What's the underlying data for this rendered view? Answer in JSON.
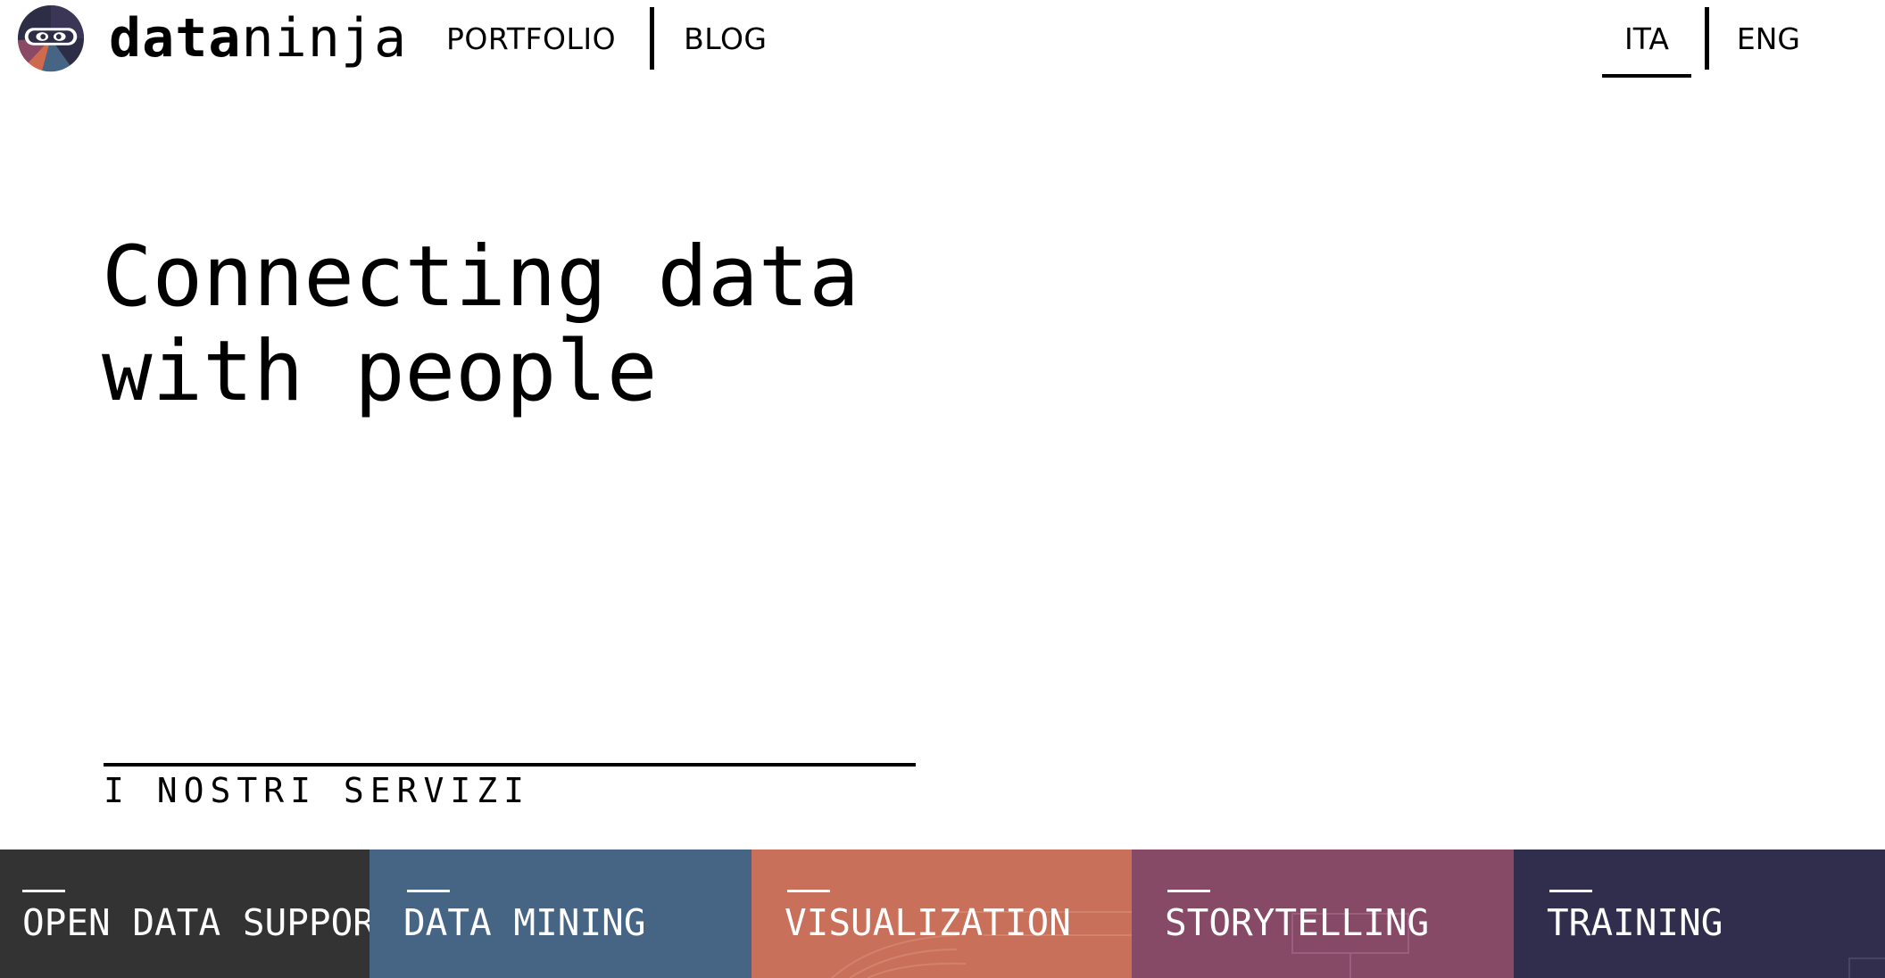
{
  "header": {
    "logo": {
      "text_bold": "data",
      "text_light": "ninja",
      "colors": {
        "dark": "#2d2e45",
        "purple": "#3b3656",
        "rose": "#8a4a66",
        "orange": "#d06a4f",
        "blue": "#466585"
      }
    },
    "nav": [
      {
        "label": "PORTFOLIO"
      },
      {
        "label": "BLOG"
      }
    ],
    "languages": [
      {
        "label": "ITA",
        "active": true
      },
      {
        "label": "ENG",
        "active": false
      }
    ]
  },
  "hero": {
    "title_line1": "Connecting data",
    "title_line2": "with people"
  },
  "services": {
    "heading": "I NOSTRI SERVIZI",
    "items": [
      {
        "label": "OPEN DATA SUPPORT",
        "color": "#333333"
      },
      {
        "label": "DATA MINING",
        "color": "#466585"
      },
      {
        "label": "VISUALIZATION",
        "color": "#c8705a"
      },
      {
        "label": "STORYTELLING",
        "color": "#874a66"
      },
      {
        "label": "TRAINING",
        "color": "#302d4d"
      }
    ]
  }
}
